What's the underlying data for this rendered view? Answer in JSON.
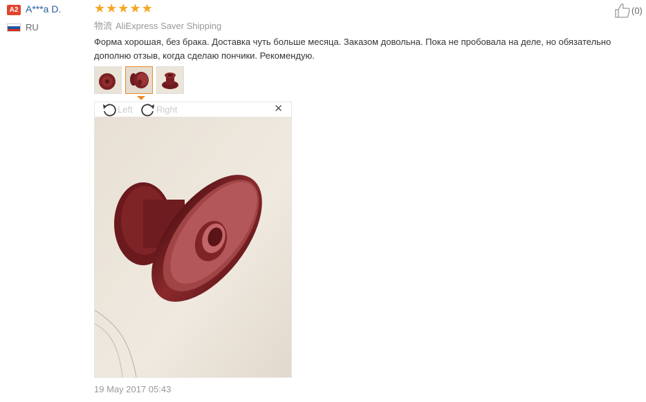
{
  "reviewer": {
    "level_badge": "A2",
    "name": "A***a D.",
    "country_code": "RU",
    "flag_colors": [
      "#ffffff",
      "#1c57a5",
      "#d52b1e"
    ]
  },
  "rating": {
    "stars": 5,
    "max": 5,
    "star_color": "#f5a623"
  },
  "helpful": {
    "icon": "thumbs-up-icon",
    "count_text": "(0)"
  },
  "logistics": {
    "label": "物流",
    "method": "AliExpress Saver Shipping"
  },
  "review": {
    "text": "Форма хорошая, без брака. Доставка чуть больше месяца. Заказом довольна. Пока не пробовала на деле, но обязательно дополню отзыв, когда сделаю пончики. Рекомендую.",
    "date": "19 May 2017 05:43"
  },
  "photos": {
    "count": 3,
    "selected_index": 1
  },
  "viewer": {
    "rotate_left_label": "Left",
    "rotate_right_label": "Right",
    "close_icon": "close-icon"
  },
  "colors": {
    "accent": "#f08a24",
    "name_link": "#2a5d9c",
    "badge": "#e0442c",
    "product": "#7a1f22"
  }
}
